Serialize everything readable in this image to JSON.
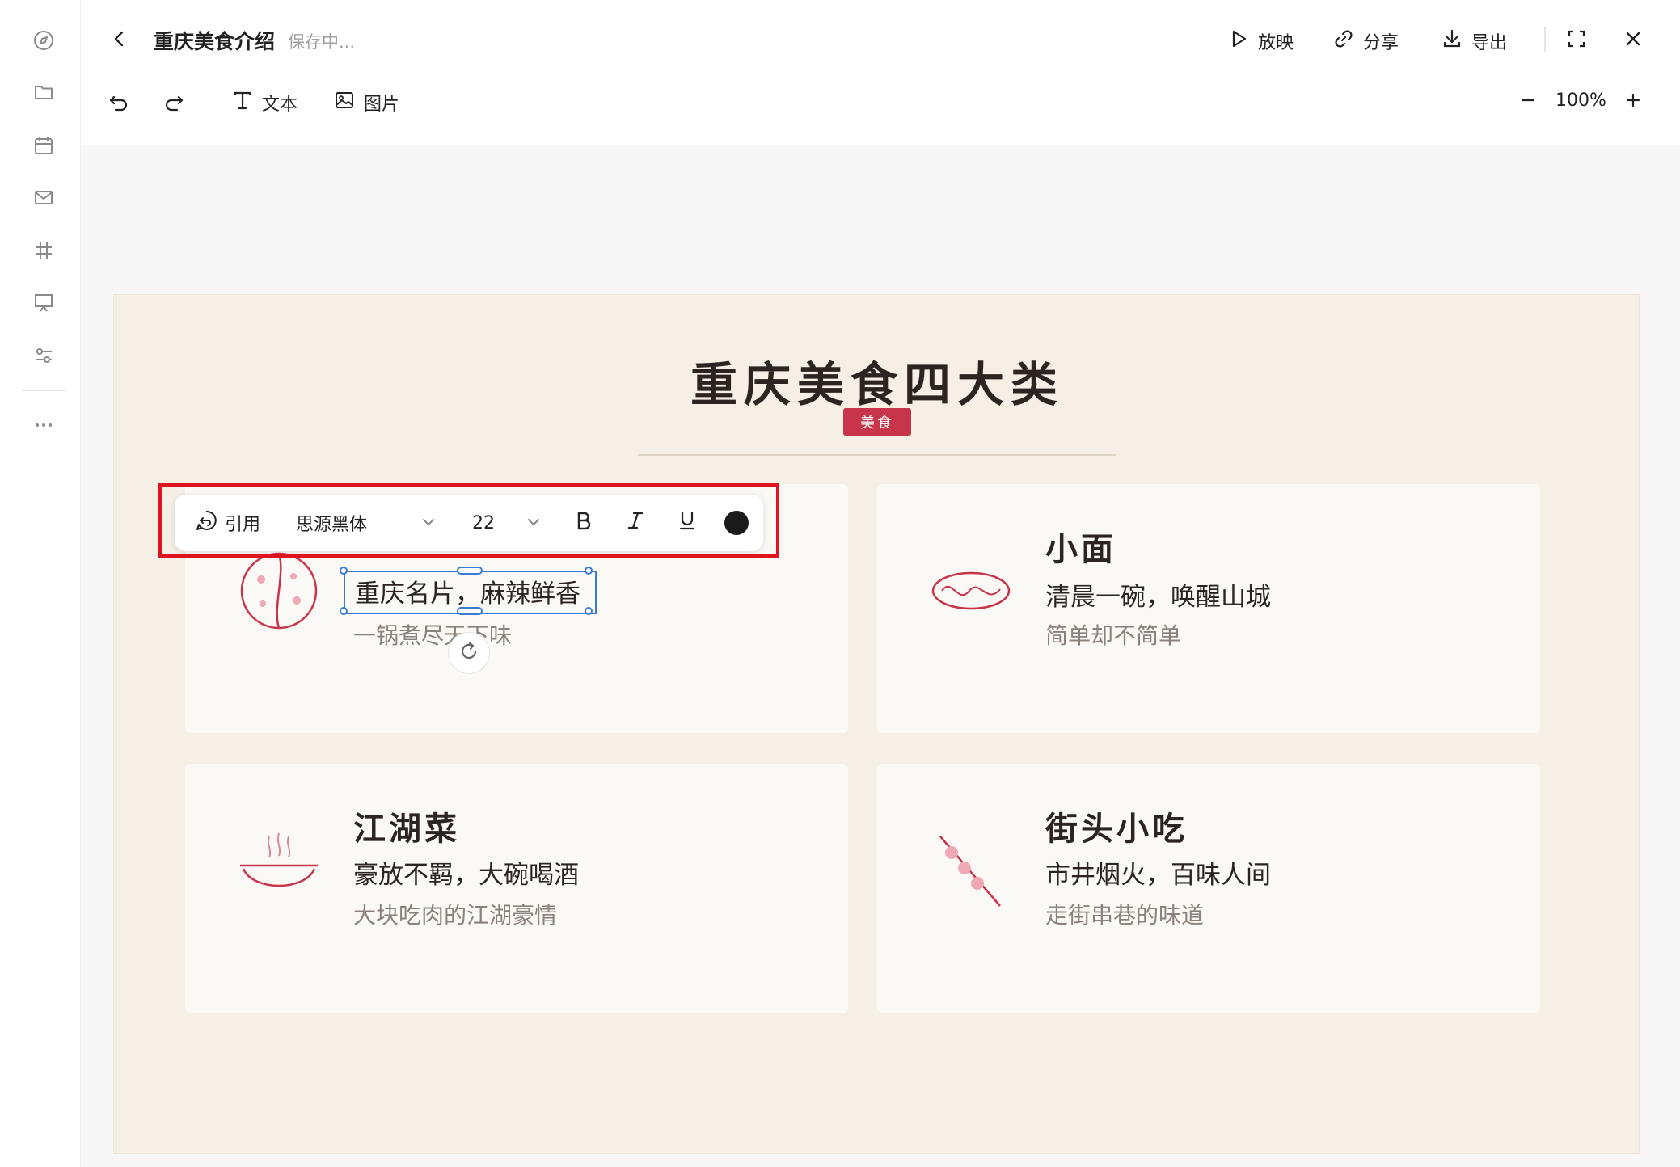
{
  "header": {
    "title": "重庆美食介绍",
    "status": "保存中...",
    "actions": {
      "present": "放映",
      "share": "分享",
      "export": "导出"
    }
  },
  "toolbar": {
    "text": "文本",
    "image": "图片",
    "zoom": "100%"
  },
  "format_bar": {
    "quote": "引用",
    "font": "思源黑体",
    "size": "22",
    "color": "#1a1a1a"
  },
  "slide": {
    "title": "重庆美食四大类",
    "badge": "美食",
    "cards": [
      {
        "subtitle": "重庆名片，麻辣鲜香",
        "desc": "一锅煮尽天下味"
      },
      {
        "title": "小面",
        "subtitle": "清晨一碗，唤醒山城",
        "desc": "简单却不简单"
      },
      {
        "title": "江湖菜",
        "subtitle": "豪放不羁，大碗喝酒",
        "desc": "大块吃肉的江湖豪情"
      },
      {
        "title": "街头小吃",
        "subtitle": "市井烟火，百味人间",
        "desc": "走街串巷的味道"
      }
    ]
  },
  "colors": {
    "accent": "#c8354a",
    "selection": "#3a7bd5",
    "highlight": "#e0141e",
    "slide_bg": "#f5efe6"
  }
}
